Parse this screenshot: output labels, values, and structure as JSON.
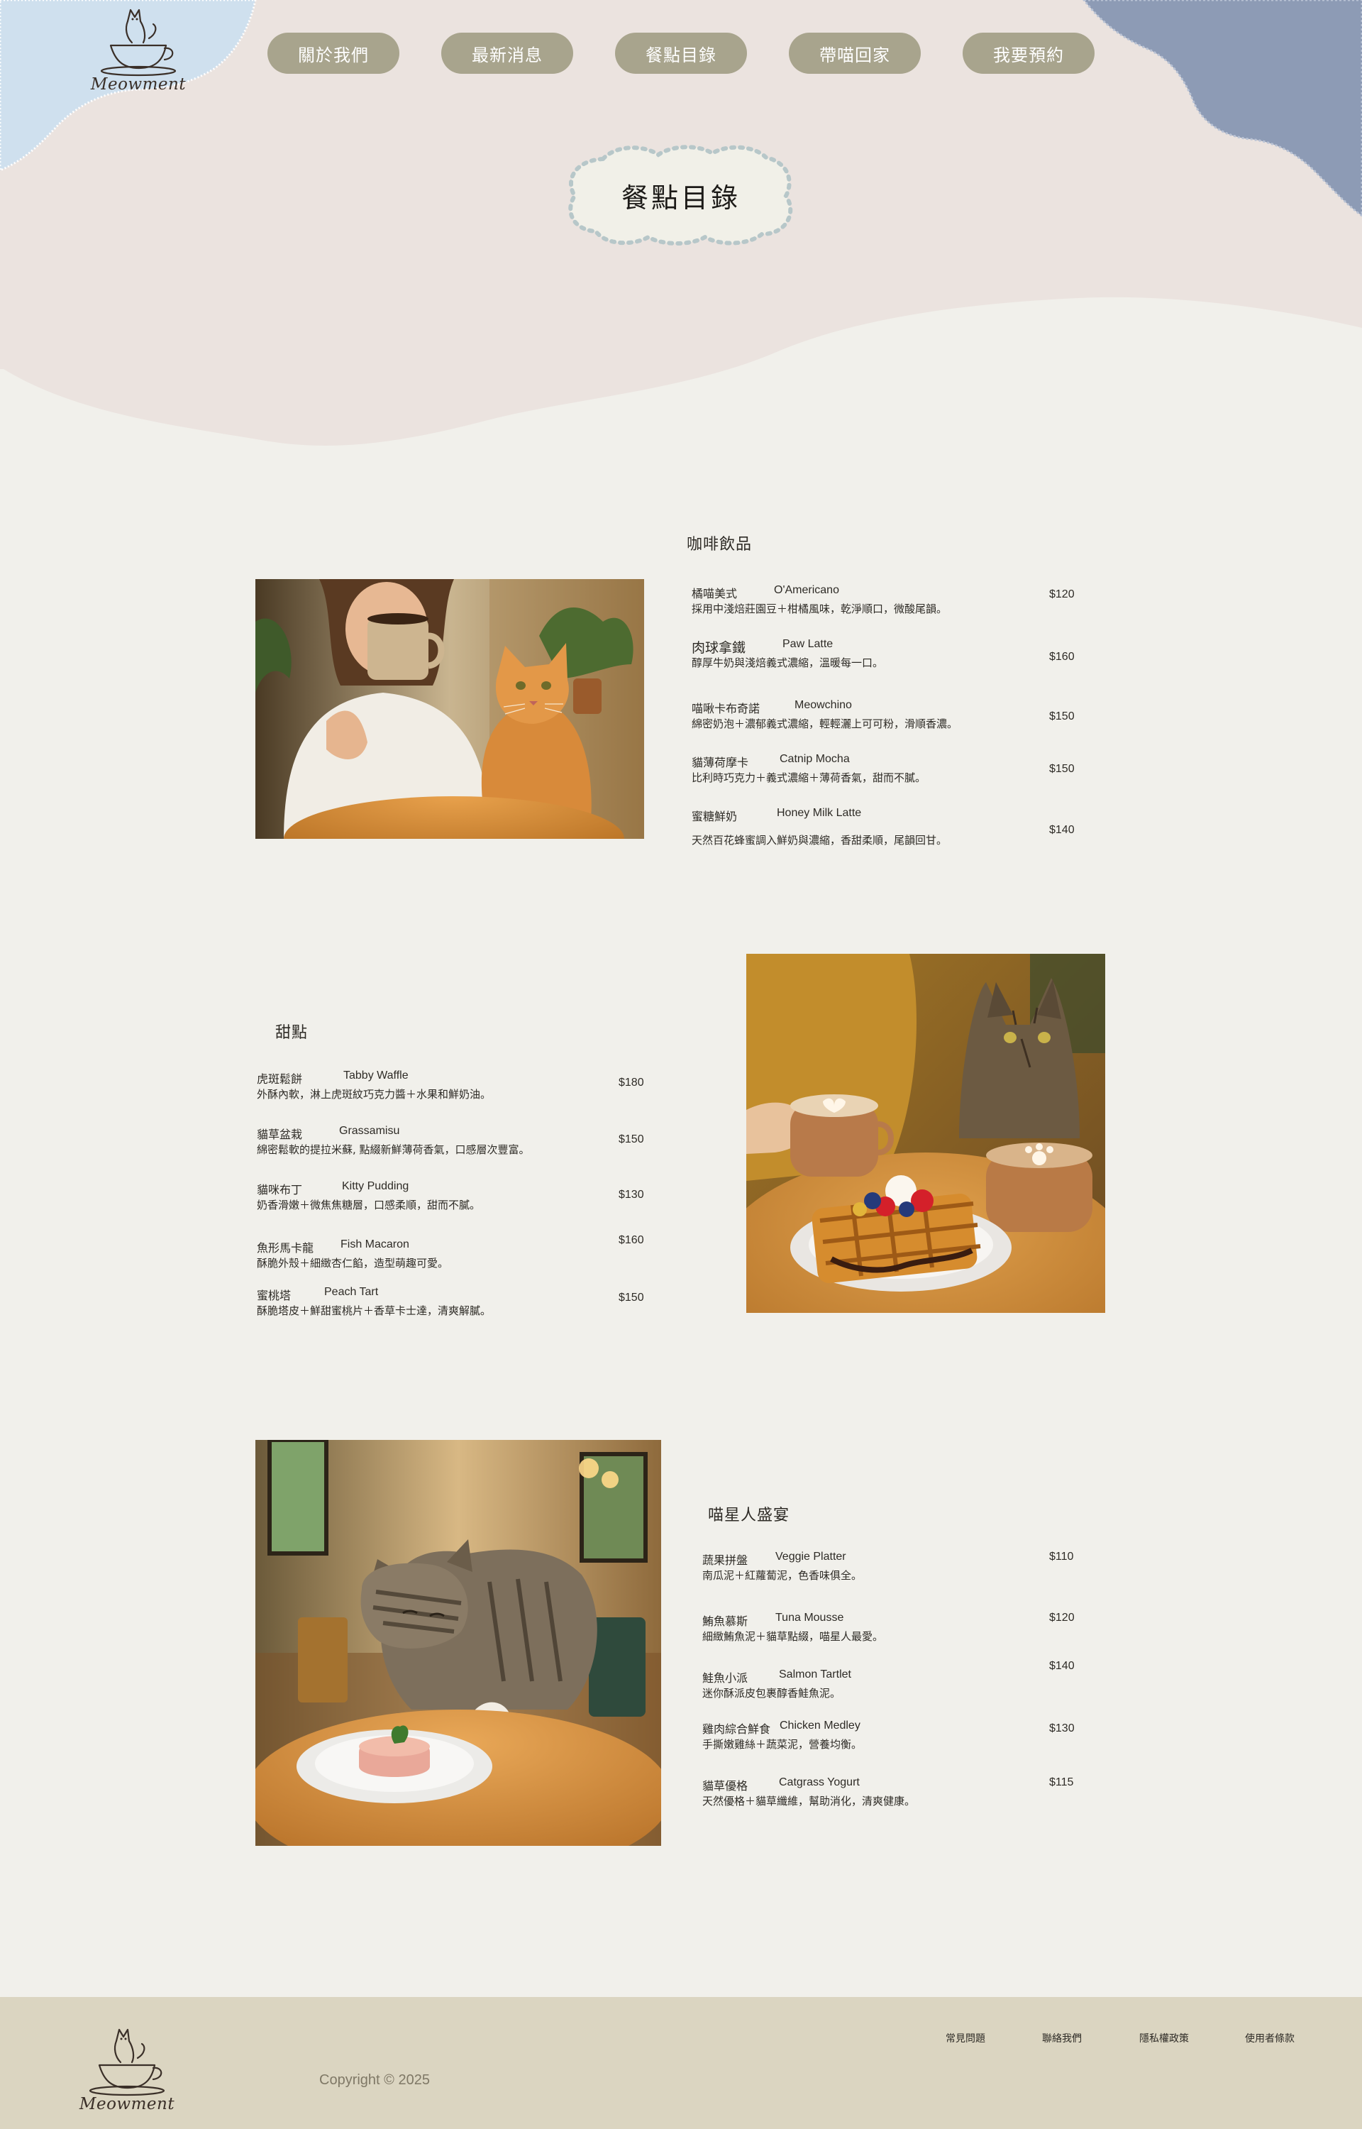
{
  "brand": {
    "name": "Meowment"
  },
  "nav": {
    "items": [
      {
        "label": "關於我們"
      },
      {
        "label": "最新消息"
      },
      {
        "label": "餐點目錄"
      },
      {
        "label": "帶喵回家"
      },
      {
        "label": "我要預約"
      }
    ]
  },
  "page_title": "餐點目錄",
  "sections": [
    {
      "title": "咖啡飲品",
      "items": [
        {
          "zh": "橘喵美式",
          "en": "O'Americano",
          "desc": "採用中淺焙莊園豆＋柑橘風味，乾淨順口，微酸尾韻。",
          "price": "$120"
        },
        {
          "zh": "肉球拿鐵",
          "en": "Paw Latte",
          "desc": "醇厚牛奶與淺焙義式濃縮，溫暖每一口。",
          "price": "$160"
        },
        {
          "zh": "喵啾卡布奇諾",
          "en": "Meowchino",
          "desc": "綿密奶泡＋濃郁義式濃縮，輕輕灑上可可粉，滑順香濃。",
          "price": "$150"
        },
        {
          "zh": "貓薄荷摩卡",
          "en": "Catnip Mocha",
          "desc": "比利時巧克力＋義式濃縮＋薄荷香氣，甜而不膩。",
          "price": "$150"
        },
        {
          "zh": "蜜糖鮮奶",
          "en": "Honey Milk Latte",
          "desc": "天然百花蜂蜜調入鮮奶與濃縮，香甜柔順，尾韻回甘。",
          "price": "$140"
        }
      ]
    },
    {
      "title": "甜點",
      "items": [
        {
          "zh": "虎斑鬆餅",
          "en": "Tabby Waffle",
          "desc": "外酥內軟，淋上虎斑紋巧克力醬＋水果和鮮奶油。",
          "price": "$180"
        },
        {
          "zh": "貓草盆栽",
          "en": "Grassamisu",
          "desc": "綿密鬆軟的提拉米蘇, 點綴新鮮薄荷香氣，口感層次豐富。",
          "price": "$150"
        },
        {
          "zh": "貓咪布丁",
          "en": "Kitty Pudding",
          "desc": "奶香滑嫩＋微焦焦糖層，口感柔順，甜而不膩。",
          "price": "$130"
        },
        {
          "zh": "魚形馬卡龍",
          "en": "Fish Macaron",
          "desc": "酥脆外殼＋細緻杏仁餡，造型萌趣可愛。",
          "price": "$160"
        },
        {
          "zh": "蜜桃塔",
          "en": "Peach Tart",
          "desc": "酥脆塔皮＋鮮甜蜜桃片＋香草卡士達，清爽解膩。",
          "price": "$150"
        }
      ]
    },
    {
      "title": "喵星人盛宴",
      "items": [
        {
          "zh": "蔬果拼盤",
          "en": "Veggie Platter",
          "desc": "南瓜泥＋紅蘿蔔泥，色香味俱全。",
          "price": "$110"
        },
        {
          "zh": "鮪魚慕斯",
          "en": "Tuna Mousse",
          "desc": "細緻鮪魚泥＋貓草點綴，喵星人最愛。",
          "price": "$120"
        },
        {
          "zh": "鮭魚小派",
          "en": "Salmon Tartlet",
          "desc": "迷你酥派皮包裹醇香鮭魚泥。",
          "price": "$140"
        },
        {
          "zh": "雞肉綜合鮮食",
          "en": "Chicken Medley",
          "desc": "手撕嫩雞絲＋蔬菜泥，營養均衡。",
          "price": "$130"
        },
        {
          "zh": "貓草優格",
          "en": "Catgrass Yogurt",
          "desc": "天然優格＋貓草纖維，幫助消化，清爽健康。",
          "price": "$115"
        }
      ]
    }
  ],
  "footer": {
    "copyright": "Copyright © 2025",
    "links": [
      {
        "label": "常見問題"
      },
      {
        "label": "聯絡我們"
      },
      {
        "label": "隱私權政策"
      },
      {
        "label": "使用者條款"
      }
    ]
  },
  "colors": {
    "page_bg": "#f1f0eb",
    "hero_bg": "#ebe3df",
    "blob_blue_light": "#cfe0ee",
    "blob_blue_dark": "#8d9bb5",
    "nav_button": "#a8a48d",
    "footer_bg": "#dbd5c1"
  }
}
